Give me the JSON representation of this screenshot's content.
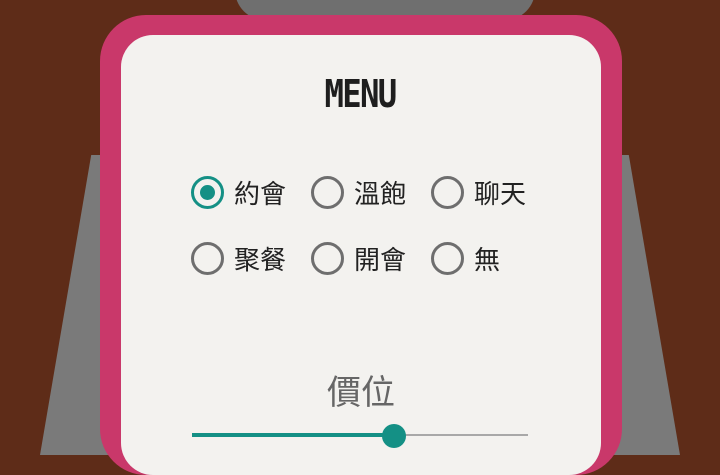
{
  "menu": {
    "title": "MENU"
  },
  "occasion_options": [
    {
      "label": "約會",
      "checked": true
    },
    {
      "label": "溫飽",
      "checked": false
    },
    {
      "label": "聊天",
      "checked": false
    },
    {
      "label": "聚餐",
      "checked": false
    },
    {
      "label": "開會",
      "checked": false
    },
    {
      "label": "無",
      "checked": false
    }
  ],
  "price": {
    "label": "價位",
    "value_fraction": 0.6
  },
  "colors": {
    "accent": "#149085",
    "frame": "#c9386a",
    "card": "#f3f2ef",
    "background": "#5e2c18"
  }
}
